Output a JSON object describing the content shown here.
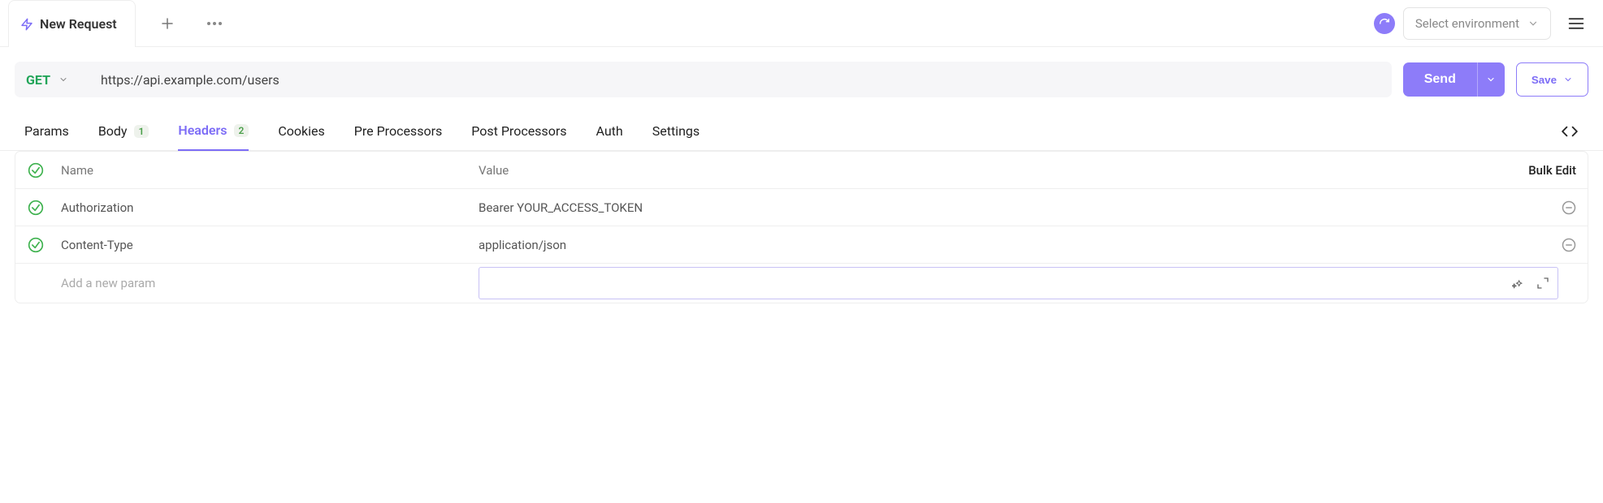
{
  "tab": {
    "title": "New Request"
  },
  "topbar": {
    "env_placeholder": "Select environment"
  },
  "request": {
    "method": "GET",
    "url": "https://api.example.com/users",
    "send_label": "Send",
    "save_label": "Save"
  },
  "subtabs": {
    "params": "Params",
    "body": "Body",
    "body_badge": "1",
    "headers": "Headers",
    "headers_badge": "2",
    "cookies": "Cookies",
    "pre": "Pre Processors",
    "post": "Post Processors",
    "auth": "Auth",
    "settings": "Settings"
  },
  "table": {
    "name_header": "Name",
    "value_header": "Value",
    "bulk_edit": "Bulk Edit",
    "new_param_placeholder": "Add a new param",
    "rows": [
      {
        "name": "Authorization",
        "value": "Bearer YOUR_ACCESS_TOKEN"
      },
      {
        "name": "Content-Type",
        "value": "application/json"
      }
    ]
  }
}
